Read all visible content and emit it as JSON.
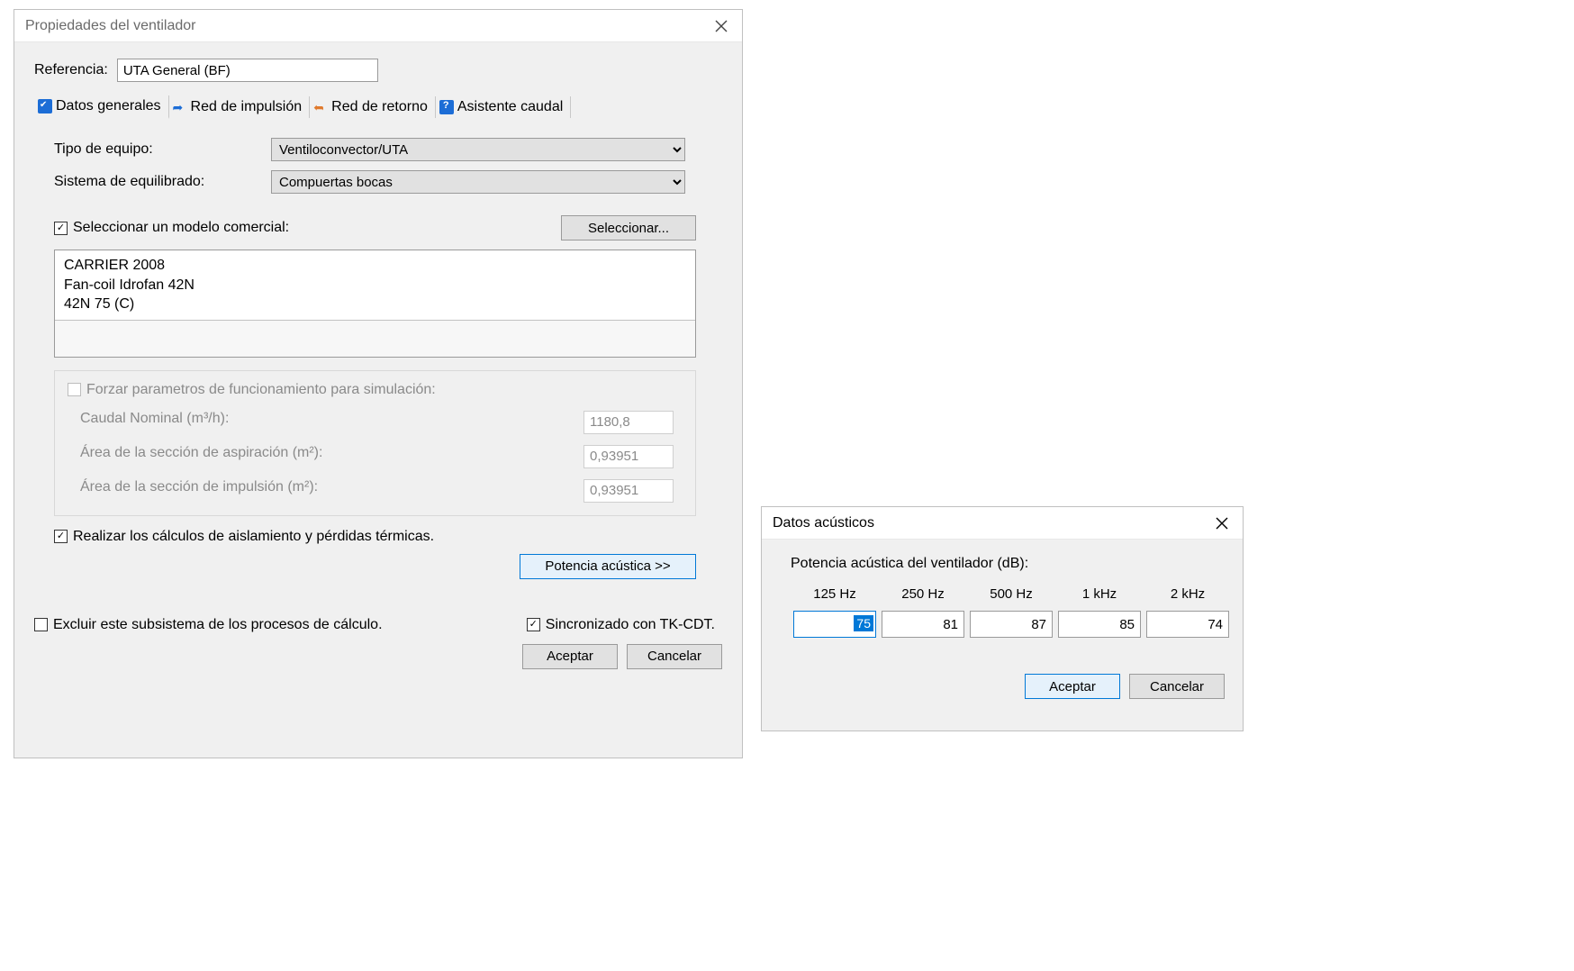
{
  "window1": {
    "title": "Propiedades del ventilador",
    "ref_label": "Referencia:",
    "ref_value": "UTA General (BF)",
    "tabs": {
      "general": "Datos generales",
      "impulsion": "Red de impulsión",
      "retorno": "Red de retorno",
      "asistente": "Asistente caudal"
    },
    "tipo_equipo_label": "Tipo de equipo:",
    "tipo_equipo_value": "Ventiloconvector/UTA",
    "sistema_label": "Sistema de equilibrado:",
    "sistema_value": "Compuertas bocas",
    "select_model_chk": "Seleccionar un modelo comercial:",
    "select_btn": "Seleccionar...",
    "model_lines": [
      "CARRIER 2008",
      "Fan-coil Idrofan 42N",
      "42N 75 (C)"
    ],
    "forzar_chk": "Forzar parametros de funcionamiento para simulación:",
    "params": {
      "caudal_label": "Caudal Nominal (m³/h):",
      "caudal_value": "1180,8",
      "area_asp_label": "Área de la sección de aspiración (m²):",
      "area_asp_value": "0,93951",
      "area_imp_label": "Área de la sección de impulsión (m²):",
      "area_imp_value": "0,93951"
    },
    "realizar_chk": "Realizar los cálculos de aislamiento y pérdidas térmicas.",
    "potencia_btn": "Potencia acústica >>",
    "excluir_chk": "Excluir este subsistema de los procesos de cálculo.",
    "sync_chk": "Sincronizado con TK-CDT.",
    "ok_btn": "Aceptar",
    "cancel_btn": "Cancelar"
  },
  "window2": {
    "title": "Datos acústicos",
    "subtitle": "Potencia acústica del ventilador (dB):",
    "cols": [
      "125 Hz",
      "250 Hz",
      "500 Hz",
      "1 kHz",
      "2 kHz"
    ],
    "vals": [
      "75",
      "81",
      "87",
      "85",
      "74"
    ],
    "ok_btn": "Aceptar",
    "cancel_btn": "Cancelar"
  }
}
